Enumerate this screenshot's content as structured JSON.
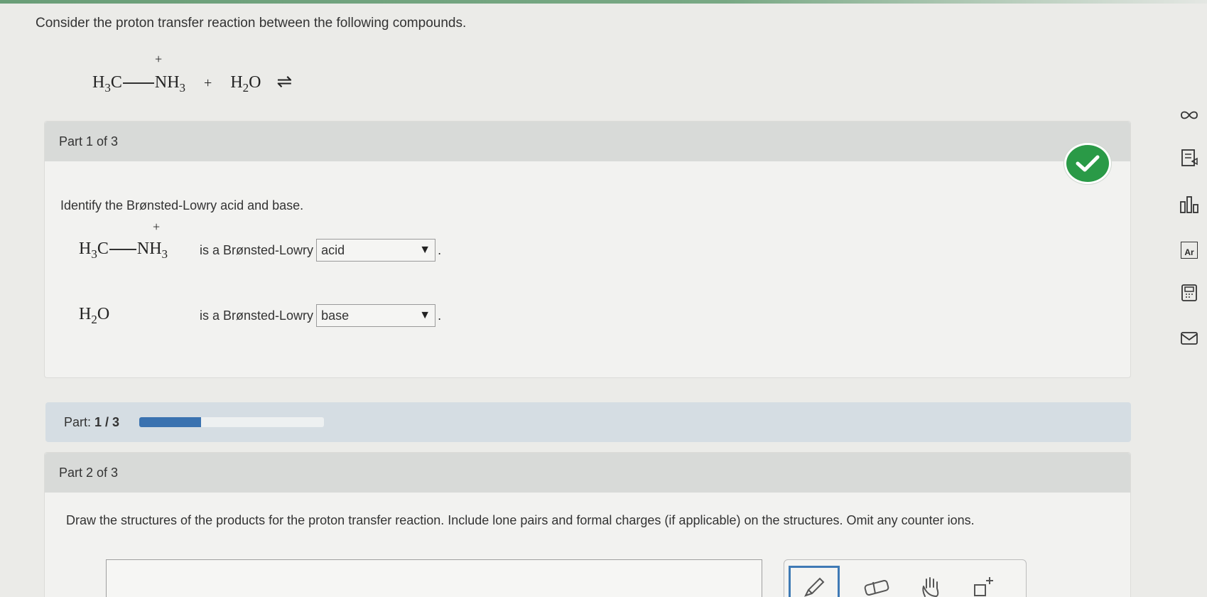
{
  "intro": "Consider the proton transfer reaction between the following compounds.",
  "reaction": {
    "reactant1": {
      "left": "H",
      "left_sub": "3",
      "c": "C",
      "n": "NH",
      "n_sub": "3",
      "charge": "+"
    },
    "plus": "+",
    "reactant2": {
      "h": "H",
      "sub": "2",
      "o": "O"
    },
    "arrow": "⇌"
  },
  "part1": {
    "header": "Part 1 of 3",
    "status_icon": "check-icon",
    "question": "Identify the Brønsted-Lowry acid and base.",
    "rows": [
      {
        "desc": "is a Brønsted-Lowry",
        "selected": "acid",
        "period": "."
      },
      {
        "desc": "is a Brønsted-Lowry",
        "selected": "base",
        "period": "."
      }
    ]
  },
  "progress": {
    "label": "Part:",
    "value_text": "1 / 3",
    "fraction": 0.333
  },
  "part2": {
    "header": "Part 2 of 3",
    "instructions": "Draw the structures of the products for the proton transfer reaction. Include lone pairs and formal charges (if applicable) on the structures. Omit any counter ions.",
    "tools": [
      "pencil-icon",
      "eraser-icon",
      "hand-icon",
      "add-template-icon"
    ]
  },
  "sidebar": {
    "icons": [
      "infinity-icon",
      "notes-icon",
      "chart-icon",
      "periodic-table-icon",
      "calculator-icon",
      "mail-icon"
    ],
    "periodic_table_text": "Ar"
  },
  "colors": {
    "accent": "#3a72b0",
    "success": "#2a9a47",
    "header": "#d8dad8"
  }
}
